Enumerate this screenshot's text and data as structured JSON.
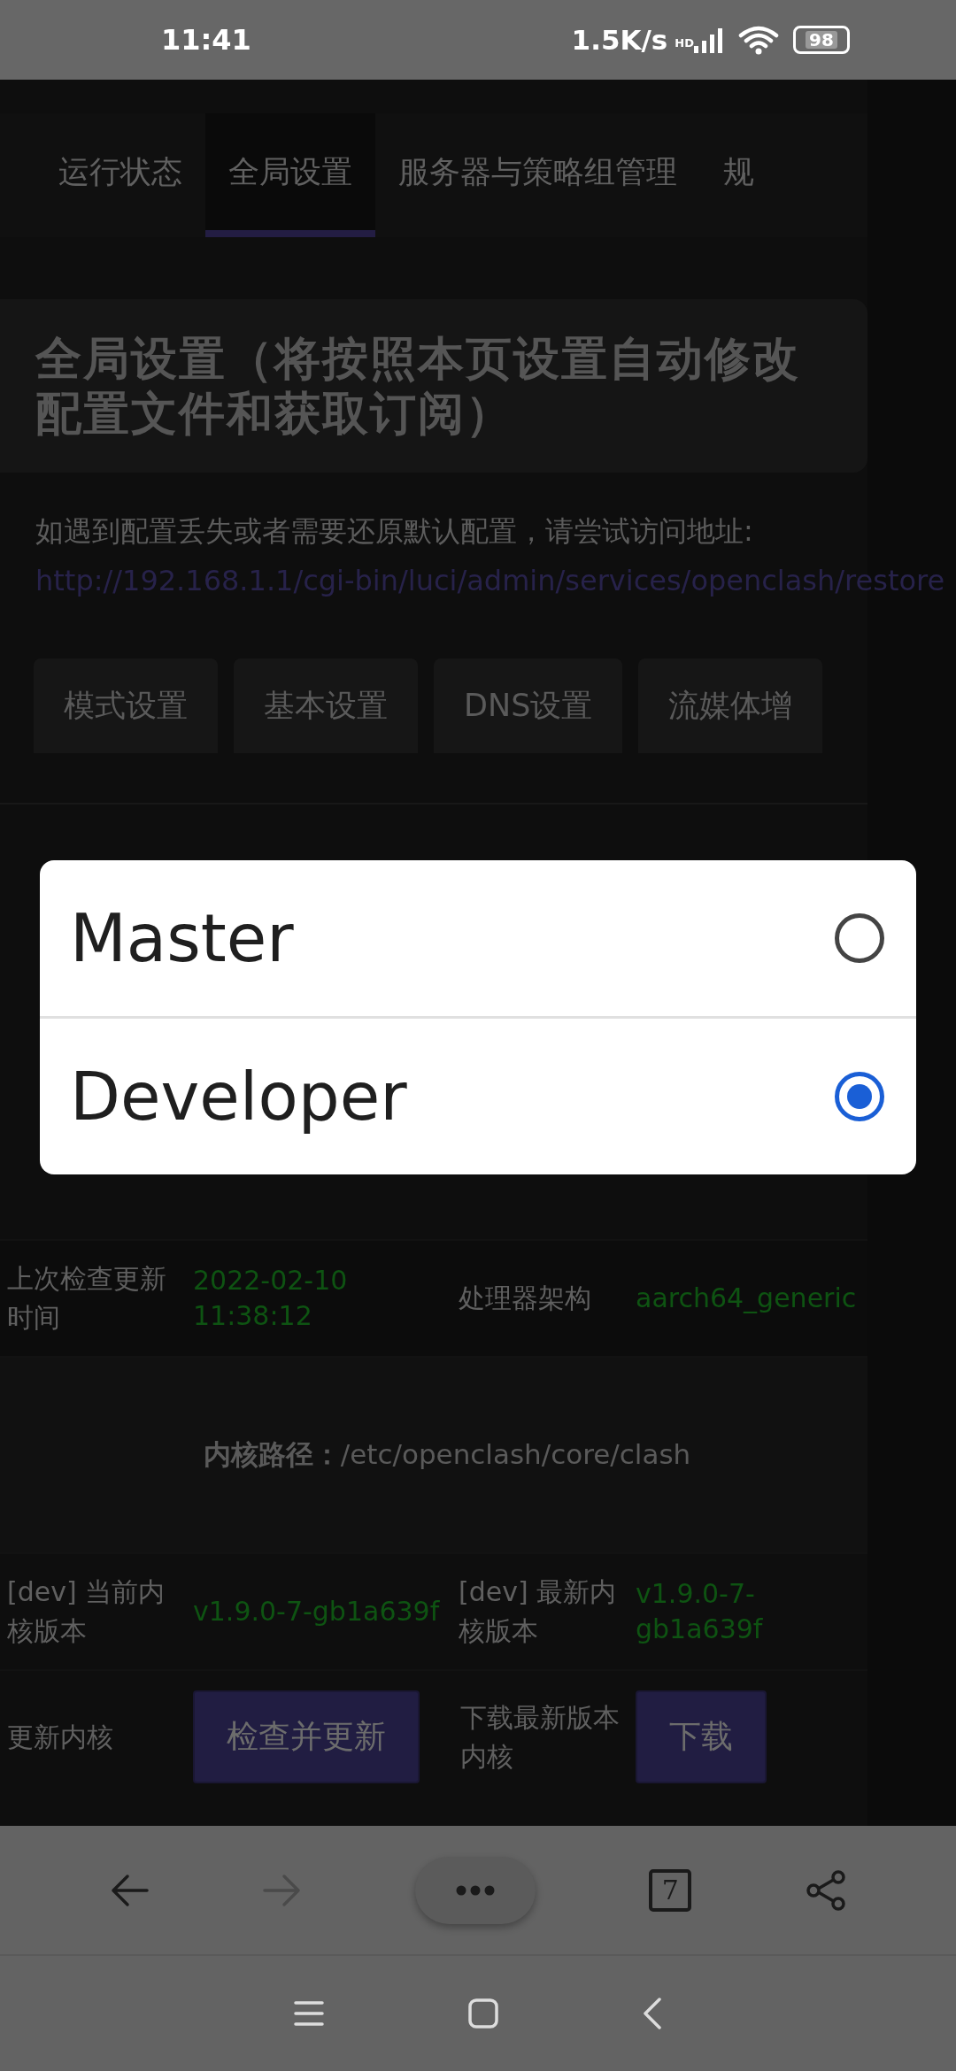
{
  "status_bar": {
    "time": "11:41",
    "speed": "1.5K/s",
    "network": "HD",
    "battery": "98"
  },
  "tabs": [
    {
      "label": "运行状态",
      "selected": false
    },
    {
      "label": "全局设置",
      "selected": true
    },
    {
      "label": "服务器与策略组管理",
      "selected": false
    },
    {
      "label": "规",
      "selected": false
    }
  ],
  "header": {
    "title": "全局设置（将按照本页设置自动修改配置文件和获取订阅）"
  },
  "notice": {
    "text": "如遇到配置丢失或者需要还原默认配置，请尝试访问地址: ",
    "link": "http://192.168.1.1/cgi-bin/luci/admin/services/openclash/restore"
  },
  "section_tabs": [
    {
      "label": "模式设置"
    },
    {
      "label": "基本设置"
    },
    {
      "label": "DNS设置"
    },
    {
      "label": "流媒体增"
    }
  ],
  "dialog": {
    "options": [
      {
        "label": "Master",
        "selected": false
      },
      {
        "label": "Developer",
        "selected": true
      }
    ]
  },
  "info_rows": [
    {
      "kind": "pair",
      "cells": [
        {
          "label": "上次检查更新时间",
          "value": "2022-02-10 11:38:12"
        },
        {
          "label": "处理器架构",
          "value": "aarch64_generic"
        }
      ]
    },
    {
      "kind": "path",
      "label": "内核路径：",
      "value": "/etc/openclash/core/clash"
    },
    {
      "kind": "pair",
      "cells": [
        {
          "label": "[dev] 当前内核版本",
          "value": "v1.9.0-7-gb1a639f"
        },
        {
          "label": "[dev] 最新内核版本",
          "value": "v1.9.0-7-gb1a639f"
        }
      ]
    },
    {
      "kind": "actions",
      "cells": [
        {
          "label": "更新内核",
          "button": "检查并更新"
        },
        {
          "label": "下载最新版本内核",
          "button": "下载"
        }
      ]
    }
  ],
  "browser_bar": {
    "tab_count": "7"
  }
}
